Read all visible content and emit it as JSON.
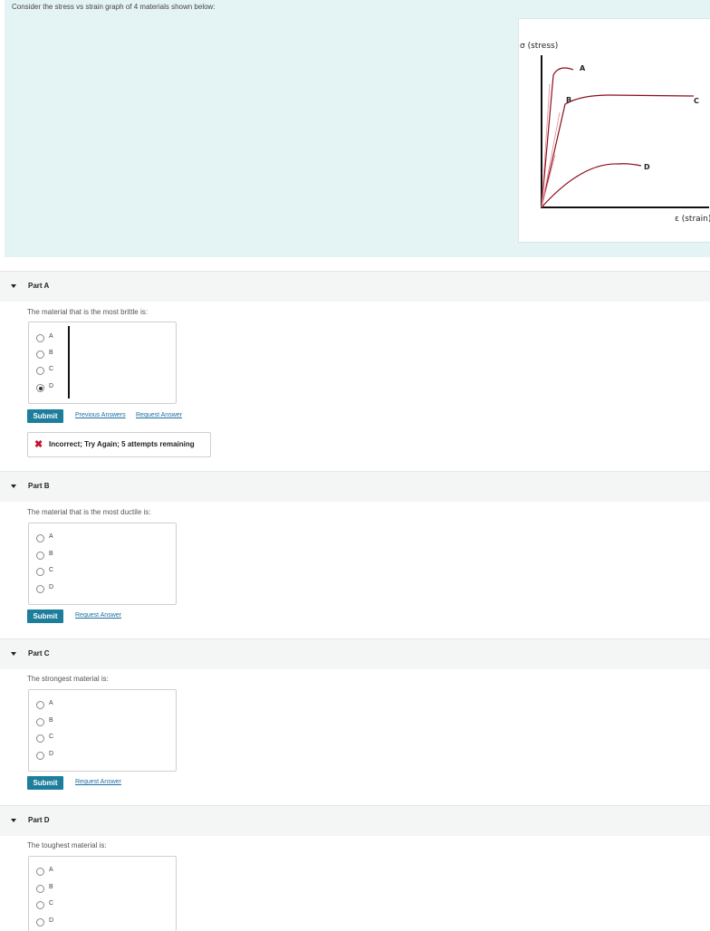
{
  "intro": {
    "text": "Consider the stress vs strain graph of 4 materials shown below:"
  },
  "graph": {
    "y_label": "σ (stress)",
    "x_label": "ε (strain)",
    "curve_labels": [
      "A",
      "B",
      "C",
      "D"
    ],
    "curve_color": "#8b0c1a"
  },
  "parts": [
    {
      "title": "Part A",
      "question": "The material that is the most brittle is:",
      "options": [
        "A",
        "B",
        "C",
        "D"
      ],
      "selected": "D",
      "submit": "Submit",
      "previous_answers": "Previous Answers",
      "request_answer": "Request Answer",
      "feedback": "Incorrect; Try Again; 5 attempts remaining"
    },
    {
      "title": "Part B",
      "question": "The material that is the most ductile is:",
      "options": [
        "A",
        "B",
        "C",
        "D"
      ],
      "submit": "Submit",
      "request_answer": "Request Answer"
    },
    {
      "title": "Part C",
      "question": "The strongest material is:",
      "options": [
        "A",
        "B",
        "C",
        "D"
      ],
      "submit": "Submit",
      "request_answer": "Request Answer"
    },
    {
      "title": "Part D",
      "question": "The toughest material is:",
      "options": [
        "A",
        "B",
        "C",
        "D"
      ]
    }
  ]
}
